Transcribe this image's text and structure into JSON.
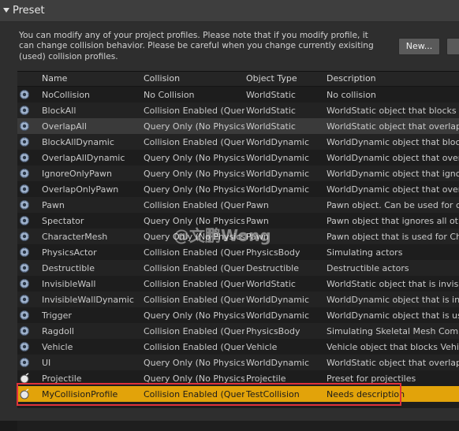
{
  "section": {
    "title": "Preset"
  },
  "notice": "You can modify any of your project profiles. Please note that if you modify profile, it can change collision behavior. Please be careful when you change currently exisiting (used) collision profiles.",
  "buttons": {
    "new_label": "New...",
    "more_label": ""
  },
  "columns": [
    "Name",
    "Collision",
    "Object Type",
    "Description"
  ],
  "rows": [
    {
      "name": "NoCollision",
      "collision": "No Collision",
      "object": "WorldStatic",
      "desc": "No collision"
    },
    {
      "name": "BlockAll",
      "collision": "Collision Enabled (Query a",
      "object": "WorldStatic",
      "desc": "WorldStatic object that blocks all"
    },
    {
      "name": "OverlapAll",
      "collision": "Query Only (No Physics C",
      "object": "WorldStatic",
      "desc": "WorldStatic object that overlaps a"
    },
    {
      "name": "BlockAllDynamic",
      "collision": "Collision Enabled (Query a",
      "object": "WorldDynamic",
      "desc": "WorldDynamic object that blocks"
    },
    {
      "name": "OverlapAllDynamic",
      "collision": "Query Only (No Physics C",
      "object": "WorldDynamic",
      "desc": "WorldDynamic object that overlap"
    },
    {
      "name": "IgnoreOnlyPawn",
      "collision": "Query Only (No Physics C",
      "object": "WorldDynamic",
      "desc": "WorldDynamic object that ignores"
    },
    {
      "name": "OverlapOnlyPawn",
      "collision": "Query Only (No Physics C",
      "object": "WorldDynamic",
      "desc": "WorldDynamic object that overlap"
    },
    {
      "name": "Pawn",
      "collision": "Collision Enabled (Query a",
      "object": "Pawn",
      "desc": "Pawn object. Can be used for caps"
    },
    {
      "name": "Spectator",
      "collision": "Query Only (No Physics C",
      "object": "Pawn",
      "desc": "Pawn object that ignores all other"
    },
    {
      "name": "CharacterMesh",
      "collision": "Query Only (No Physics C",
      "object": "Pawn",
      "desc": "Pawn object that is used for Chara"
    },
    {
      "name": "PhysicsActor",
      "collision": "Collision Enabled (Query a",
      "object": "PhysicsBody",
      "desc": "Simulating actors"
    },
    {
      "name": "Destructible",
      "collision": "Collision Enabled (Query a",
      "object": "Destructible",
      "desc": "Destructible actors"
    },
    {
      "name": "InvisibleWall",
      "collision": "Collision Enabled (Query a",
      "object": "WorldStatic",
      "desc": "WorldStatic object that is invisibl"
    },
    {
      "name": "InvisibleWallDynamic",
      "collision": "Collision Enabled (Query a",
      "object": "WorldDynamic",
      "desc": "WorldDynamic object that is invis"
    },
    {
      "name": "Trigger",
      "collision": "Query Only (No Physics C",
      "object": "WorldDynamic",
      "desc": "WorldDynamic object that is used"
    },
    {
      "name": "Ragdoll",
      "collision": "Collision Enabled (Query a",
      "object": "PhysicsBody",
      "desc": "Simulating Skeletal Mesh Compo"
    },
    {
      "name": "Vehicle",
      "collision": "Collision Enabled (Query a",
      "object": "Vehicle",
      "desc": "Vehicle object that blocks Vehicle"
    },
    {
      "name": "UI",
      "collision": "Query Only (No Physics C",
      "object": "WorldDynamic",
      "desc": "WorldStatic object that overlaps a"
    },
    {
      "name": "Projectile",
      "collision": "Query Only (No Physics C",
      "object": "Projectile",
      "desc": "Preset for projectiles"
    },
    {
      "name": "MyCollisionProfile",
      "collision": "Collision Enabled (Query a",
      "object": "TestCollision",
      "desc": "Needs description"
    }
  ],
  "watermark": "@文鹏Wong",
  "colors": {
    "selected_row": "#e2a30a",
    "highlight_border": "#e0323a"
  }
}
